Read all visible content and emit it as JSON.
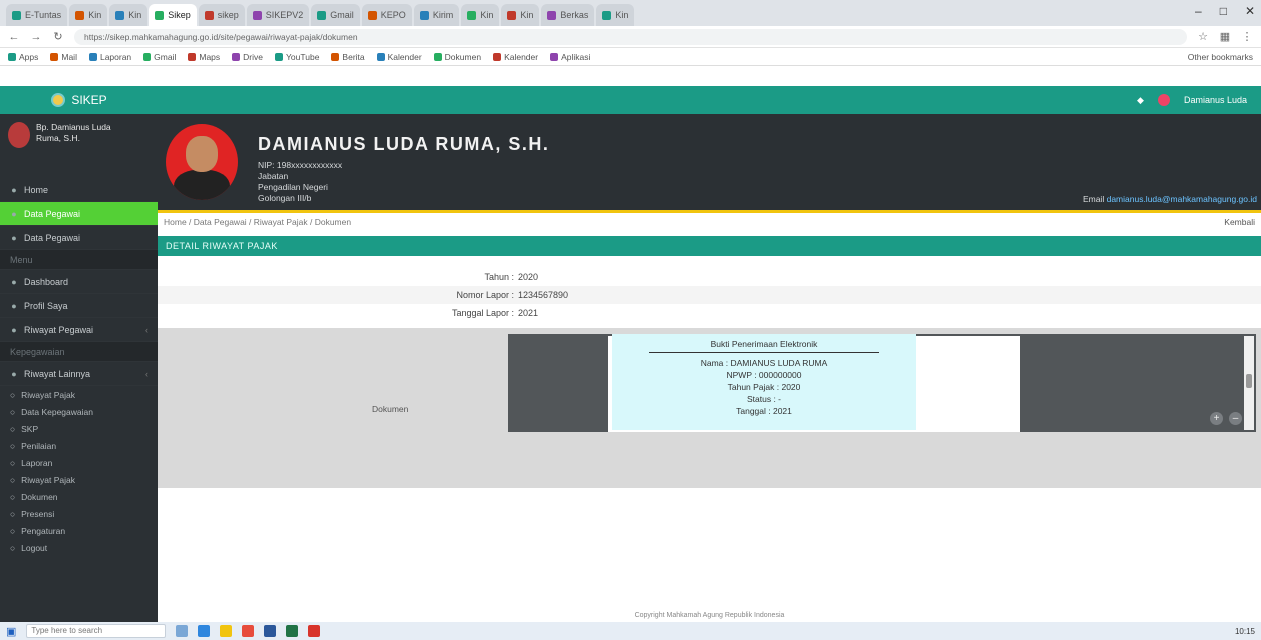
{
  "browser": {
    "tabs": [
      "E-Tuntas",
      "Kin",
      "Kin",
      "Sikep",
      "sikep",
      "SIKEPV2",
      "Gmail",
      "KEPO",
      "Kirim",
      "Kin",
      "Kin",
      "Berkas",
      "Kin"
    ],
    "active_tab": 3,
    "url": "https://sikep.mahkamahagung.go.id/site/pegawai/riwayat-pajak/dokumen",
    "bookmarks": [
      "Apps",
      "Mail",
      "Laporan",
      "Gmail",
      "Maps",
      "Drive",
      "YouTube",
      "Berita",
      "Kalender",
      "Dokumen",
      "Kalender",
      "Aplikasi"
    ],
    "other_bookmarks": "Other bookmarks"
  },
  "header": {
    "brand": "SIKEP",
    "user_name": "Damianus Luda"
  },
  "sidebar": {
    "user_line1": "Bp. Damianus Luda",
    "user_line2": "Ruma, S.H.",
    "items": [
      {
        "label": "Home",
        "type": "item"
      },
      {
        "label": "Data Pegawai",
        "type": "active"
      },
      {
        "label": "Data Pegawai",
        "type": "item"
      },
      {
        "label": "Menu",
        "type": "header"
      },
      {
        "label": "Dashboard",
        "type": "item"
      },
      {
        "label": "Profil Saya",
        "type": "item"
      },
      {
        "label": "Riwayat Pegawai",
        "type": "item",
        "caret": true
      },
      {
        "label": "Kepegawaian",
        "type": "header"
      },
      {
        "label": "Riwayat Lainnya",
        "type": "item",
        "caret": true
      }
    ],
    "sub_items": [
      "Riwayat Pajak",
      "Data Kepegawaian",
      "SKP",
      "Penilaian",
      "Laporan",
      "Riwayat Pajak",
      "Dokumen",
      "Presensi",
      "Pengaturan",
      "Logout"
    ]
  },
  "profile": {
    "name": "DAMIANUS LUDA RUMA, S.H.",
    "lines": [
      "NIP: 198xxxxxxxxxxxx",
      "Jabatan",
      "Pengadilan Negeri",
      "Golongan III/b"
    ],
    "email_label": "Email",
    "email": "damianus.luda@mahkamahagung.go.id"
  },
  "breadcrumb": {
    "path": "Home / Data Pegawai / Riwayat Pajak / Dokumen",
    "back": "Kembali"
  },
  "section": {
    "title": "DETAIL RIWAYAT PAJAK"
  },
  "detail": {
    "rows": [
      {
        "label": "Tahun :",
        "value": "2020"
      },
      {
        "label": "Nomor Lapor :",
        "value": "1234567890"
      },
      {
        "label": "Tanggal Lapor :",
        "value": "2021"
      }
    ],
    "doc_label": "Dokumen",
    "doc_lines": [
      "Bukti Penerimaan Elektronik",
      "Nama : DAMIANUS LUDA RUMA",
      "NPWP : 000000000",
      "Tahun Pajak : 2020",
      "Status : -",
      "Tanggal : 2021"
    ]
  },
  "footer": "Copyright Mahkamah Agung Republik Indonesia",
  "taskbar": {
    "search": "Type here to search",
    "clock": "10:15"
  },
  "colors": {
    "accent": "#1b9b86",
    "active_sidebar": "#54d036",
    "sidebar_bg": "#2b3034"
  }
}
